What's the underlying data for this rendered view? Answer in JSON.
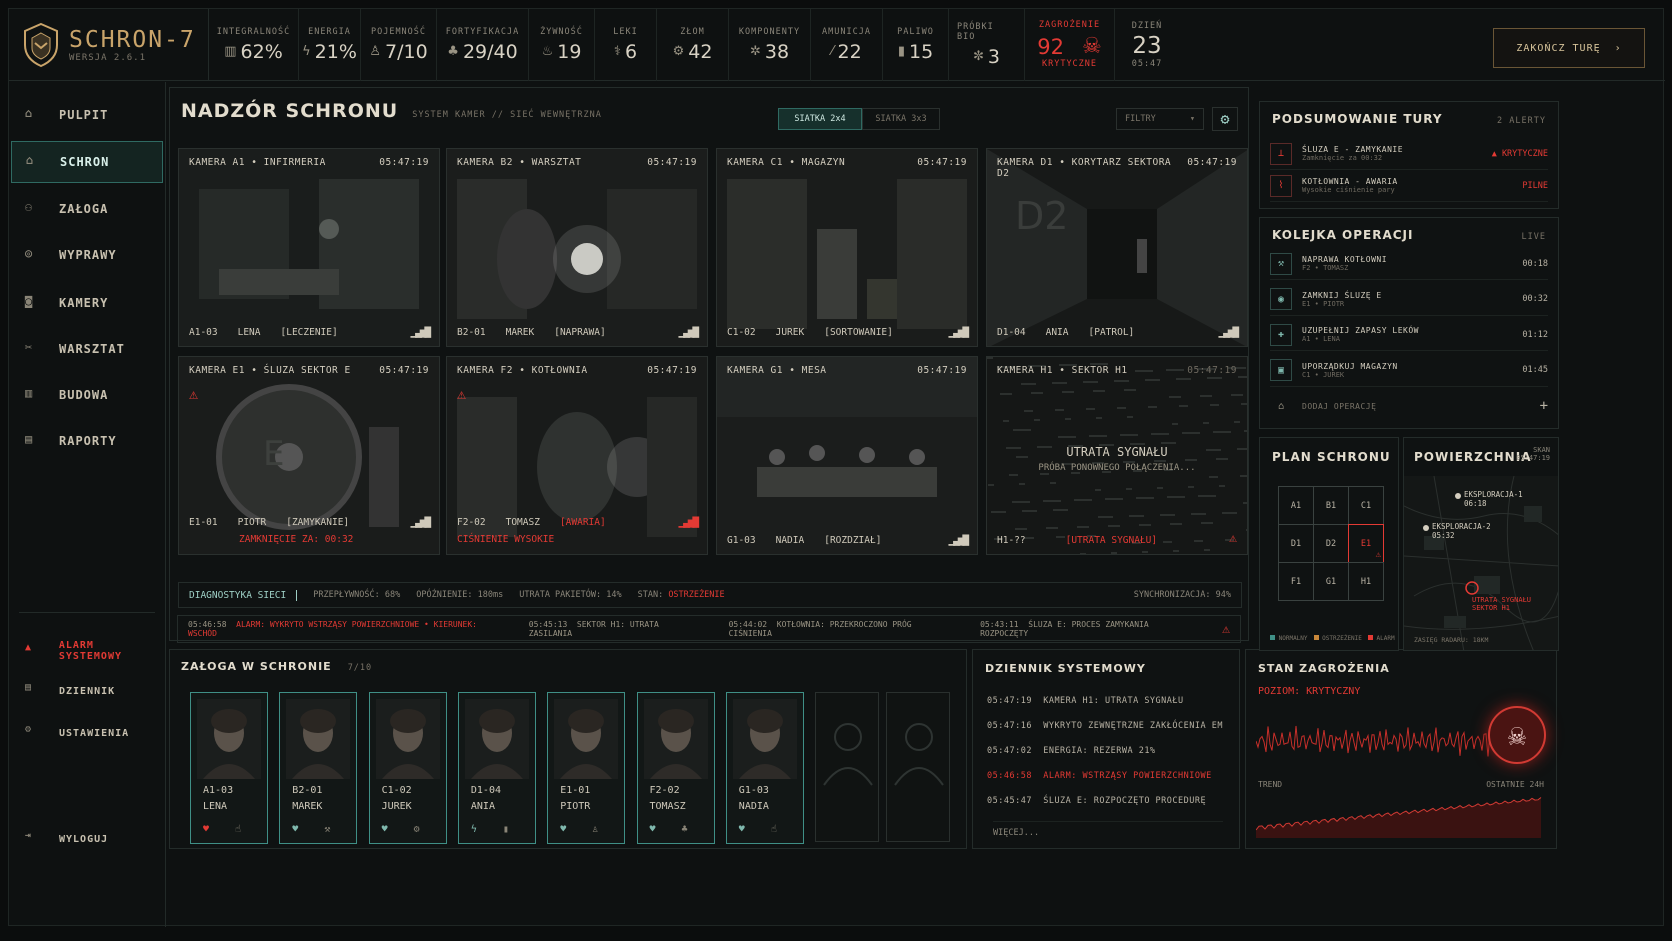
{
  "app": {
    "name": "SCHRON-7",
    "version": "WERSJA 2.6.1"
  },
  "stats": [
    {
      "label": "INTEGRALNOŚĆ",
      "value": "62%",
      "icon": "shield-icon"
    },
    {
      "label": "ENERGIA",
      "value": "21%",
      "icon": "lightning-icon"
    },
    {
      "label": "POJEMNOŚĆ",
      "value": "7/10",
      "icon": "person-icon"
    },
    {
      "label": "FORTYFIKACJA",
      "value": "29/40",
      "icon": "fort-icon"
    },
    {
      "label": "ŻYWNOŚĆ",
      "value": "19",
      "icon": "food-icon"
    },
    {
      "label": "LEKI",
      "value": "6",
      "icon": "med-icon"
    },
    {
      "label": "ZŁOM",
      "value": "42",
      "icon": "scrap-icon"
    },
    {
      "label": "KOMPONENTY",
      "value": "38",
      "icon": "gear-icon"
    },
    {
      "label": "AMUNICJA",
      "value": "22",
      "icon": "ammo-icon"
    },
    {
      "label": "PALIWO",
      "value": "15",
      "icon": "fuel-icon"
    },
    {
      "label": "PRÓBKI BIO",
      "value": "3",
      "icon": "bio-icon"
    }
  ],
  "threat": {
    "label": "ZAGROŻENIE",
    "value": "92",
    "sub": "KRYTYCZNE"
  },
  "day": {
    "label": "DZIEŃ",
    "value": "23",
    "time": "05:47"
  },
  "end_turn": "ZAKOŃCZ TURĘ",
  "nav": {
    "items": [
      "PULPIT",
      "SCHRON",
      "ZAŁOGA",
      "WYPRAWY",
      "KAMERY",
      "WARSZTAT",
      "BUDOWA",
      "RAPORTY"
    ],
    "alarm": "ALARM SYSTEMOWY",
    "log": "DZIENNIK",
    "settings": "USTAWIENIA",
    "logout": "WYLOGUJ"
  },
  "monitor": {
    "title": "NADZÓR SCHRONU",
    "subtitle": "SYSTEM KAMER // SIEĆ WEWNĘTRZNA",
    "grid1": "SIATKA 2x4",
    "grid2": "SIATKA 3x3",
    "filter": "FILTRY"
  },
  "cameras": [
    {
      "name": "KAMERA A1 • INFIRMERIA",
      "time": "05:47:19",
      "id": "A1-03",
      "person": "LENA",
      "task": "[LECZENIE]"
    },
    {
      "name": "KAMERA B2 • WARSZTAT",
      "time": "05:47:19",
      "id": "B2-01",
      "person": "MAREK",
      "task": "[NAPRAWA]"
    },
    {
      "name": "KAMERA C1 • MAGAZYN",
      "time": "05:47:19",
      "id": "C1-02",
      "person": "JUREK",
      "task": "[SORTOWANIE]"
    },
    {
      "name": "KAMERA D1 • KORYTARZ SEKTORA D2",
      "time": "05:47:19",
      "id": "D1-04",
      "person": "ANIA",
      "task": "[PATROL]"
    },
    {
      "name": "KAMERA E1 • ŚLUZA SEKTOR E",
      "time": "05:47:19",
      "id": "E1-01",
      "person": "PIOTR",
      "task": "[ZAMYKANIE]",
      "alert": "ZAMKNIĘCIE ZA: 00:32"
    },
    {
      "name": "KAMERA F2 • KOTŁOWNIA",
      "time": "05:47:19",
      "id": "F2-02",
      "person": "TOMASZ",
      "task": "[AWARIA]",
      "alert": "CIŚNIENIE WYSOKIE"
    },
    {
      "name": "KAMERA G1 • MESA",
      "time": "05:47:19",
      "id": "G1-03",
      "person": "NADIA",
      "task": "[ROZDZIAŁ]"
    },
    {
      "name": "KAMERA H1 • SEKTOR H1",
      "time": "05:47:19",
      "id": "H1-??",
      "person": "",
      "task": "[UTRATA SYGNAŁU]",
      "lost": "UTRATA SYGNAŁU",
      "retry": "PRÓBA PONOWNEGO POŁĄCZENIA..."
    }
  ],
  "diag": {
    "label": "DIAGNOSTYKA SIECI",
    "throughput": "PRZEPŁYWNOŚĆ: 68%",
    "latency": "OPÓŹNIENIE: 180ms",
    "loss": "UTRATA PAKIETÓW: 14%",
    "state_label": "STAN:",
    "state": "OSTRZEŻENIE",
    "sync": "SYNCHRONIZACJA: 94%"
  },
  "ticker": [
    {
      "time": "05:46:58",
      "text": "ALARM: WYKRYTO WSTRZĄSY POWIERZCHNIOWE • KIERUNEK: WSCHÓD",
      "alarm": true
    },
    {
      "time": "05:45:13",
      "text": "SEKTOR H1: UTRATA ZASILANIA"
    },
    {
      "time": "05:44:02",
      "text": "KOTŁOWNIA: PRZEKROCZONO PRÓG CIŚNIENIA"
    },
    {
      "time": "05:43:11",
      "text": "ŚLUZA E: PROCES ZAMYKANIA ROZPOCZĘTY"
    }
  ],
  "crew": {
    "title": "ZAŁOGA W SCHRONIE",
    "count": "7/10",
    "members": [
      {
        "id": "A1-03",
        "name": "LENA"
      },
      {
        "id": "B2-01",
        "name": "MAREK"
      },
      {
        "id": "C1-02",
        "name": "JUREK"
      },
      {
        "id": "D1-04",
        "name": "ANIA"
      },
      {
        "id": "E1-01",
        "name": "PIOTR"
      },
      {
        "id": "F2-02",
        "name": "TOMASZ"
      },
      {
        "id": "G1-03",
        "name": "NADIA"
      }
    ]
  },
  "syslog": {
    "title": "DZIENNIK SYSTEMOWY",
    "more": "WIĘCEJ...",
    "entries": [
      {
        "time": "05:47:19",
        "text": "KAMERA H1: UTRATA SYGNAŁU"
      },
      {
        "time": "05:47:16",
        "text": "WYKRYTO ZEWNĘTRZNE ZAKŁÓCENIA EM"
      },
      {
        "time": "05:47:02",
        "text": "ENERGIA: REZERWA 21%"
      },
      {
        "time": "05:46:58",
        "text": "ALARM: WSTRZĄSY POWIERZCHNIOWE",
        "alarm": true
      },
      {
        "time": "05:45:47",
        "text": "ŚLUZA E: ROZPOCZĘTO PROCEDURĘ"
      }
    ]
  },
  "threat_panel": {
    "title": "STAN ZAGROŻENIA",
    "level": "POZIOM: KRYTYCZNY",
    "trend": "TREND",
    "range": "OSTATNIE 24H"
  },
  "summary": {
    "title": "PODSUMOWANIE TURY",
    "alerts": "2 ALERTY",
    "items": [
      {
        "t1": "ŚLUZA E - ZAMYKANIE",
        "t2": "Zamknięcie za 00:32",
        "tag": "KRYTYCZNE"
      },
      {
        "t1": "KOTŁOWNIA - AWARIA",
        "t2": "Wysokie ciśnienie pary",
        "tag": "PILNE"
      }
    ]
  },
  "queue": {
    "title": "KOLEJKA OPERACJI",
    "live": "LIVE",
    "add": "DODAJ OPERACJĘ",
    "items": [
      {
        "t1": "NAPRAWA KOTŁOWNI",
        "t2": "F2 • TOMASZ",
        "time": "00:18"
      },
      {
        "t1": "ZAMKNIJ ŚLUZĘ E",
        "t2": "E1 • PIOTR",
        "time": "00:32"
      },
      {
        "t1": "UZUPEŁNIJ ZAPASY LEKÓW",
        "t2": "A1 • LENA",
        "time": "01:12"
      },
      {
        "t1": "UPORZĄDKUJ MAGAZYN",
        "t2": "C1 • JUREK",
        "time": "01:45"
      }
    ]
  },
  "plan": {
    "title": "PLAN SCHRONU",
    "cells": [
      "A1",
      "B1",
      "C1",
      "D1",
      "D2",
      "E1",
      "F1",
      "G1",
      "H1"
    ],
    "legend": [
      "NORMALNY",
      "OSTRZEŻENIE",
      "ALARM"
    ]
  },
  "surface": {
    "title": "POWIERZCHNIA",
    "scan": "SKAN",
    "scan_time": "05:47:19",
    "exp1": "EKSPLORACJA-1",
    "exp1_t": "06:18",
    "exp2": "EKSPLORACJA-2",
    "exp2_t": "05:32",
    "lost": "UTRATA SYGNAŁU",
    "lost_sector": "SEKTOR H1",
    "radar": "ZASIĘG RADARU: 18KM"
  },
  "colors": {
    "accent": "#3f8f86",
    "danger": "#e33a34",
    "gold": "#c9a46a"
  }
}
